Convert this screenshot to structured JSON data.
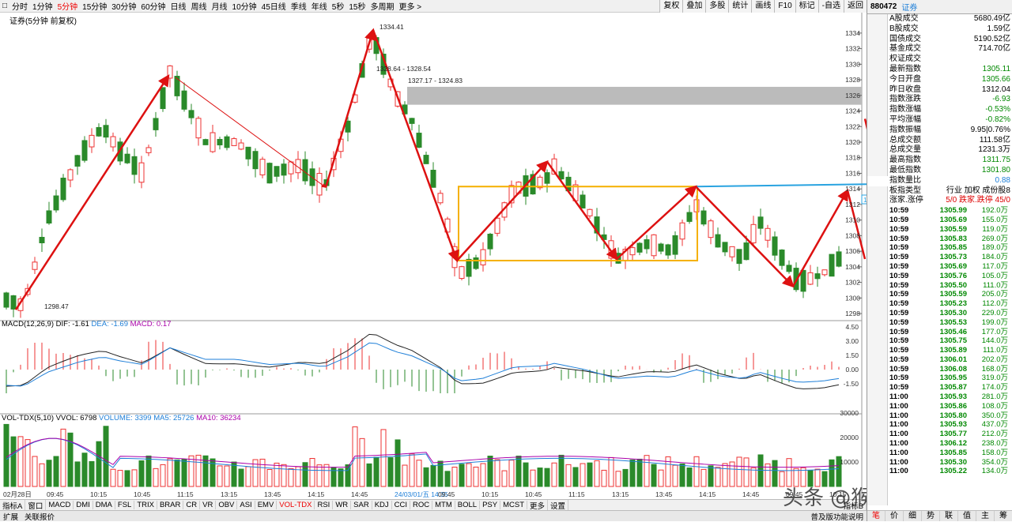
{
  "toolbar": {
    "period_tabs": [
      "分时",
      "1分钟",
      "5分钟",
      "15分钟",
      "30分钟",
      "60分钟",
      "日线",
      "周线",
      "月线",
      "10分钟",
      "45日线",
      "季线",
      "年线",
      "5秒",
      "15秒",
      "多周期",
      "更多 >"
    ],
    "active_period": "5分钟",
    "tools": [
      "复权",
      "叠加",
      "多股",
      "统计",
      "画线",
      "F10",
      "标记",
      "-自选",
      "返回"
    ]
  },
  "chart": {
    "title": "证券(5分钟 前复权)",
    "price_labels": [
      "1334",
      "1332",
      "1330",
      "1328",
      "1326",
      "1324",
      "1322",
      "1320",
      "1318",
      "1316",
      "1314",
      "1312",
      "1310",
      "1308",
      "1306",
      "1304",
      "1302",
      "1300",
      "1298"
    ],
    "annotations": {
      "high": "1334.41",
      "low": "1298.47",
      "range1": "1328.64 - 1328.54",
      "range2": "1327.17 - 1324.83",
      "current_tag": "1312.3",
      "pattern": "2B"
    },
    "time_labels": [
      "02月28日",
      "09:45",
      "10:15",
      "10:45",
      "11:15",
      "13:15",
      "13:45",
      "14:15",
      "14:45",
      "24/03/01/五 14:35",
      "09:45",
      "10:15",
      "10:45",
      "11:15",
      "13:15",
      "13:45",
      "14:15",
      "14:45",
      "09:45",
      "10:15"
    ]
  },
  "macd": {
    "title": "MACD(12,26,9)",
    "dif": "DIF: -1.61",
    "dea": "DEA: -1.69",
    "macd": "MACD: 0.17",
    "axis": [
      "4.50",
      "3.00",
      "1.50",
      "0.00",
      "-1.50"
    ]
  },
  "vol": {
    "title": "VOL-TDX(5,10)",
    "vvol": "VVOL: 6798",
    "volume": "VOLUME: 3399",
    "ma5": "MA5: 25726",
    "ma10": "MA10: 36234",
    "axis": [
      "30000",
      "20000",
      "10000"
    ]
  },
  "bottom_tabs": [
    "指标A",
    "窗口",
    "MACD",
    "DMI",
    "DMA",
    "FSL",
    "TRIX",
    "BRAR",
    "CR",
    "VR",
    "OBV",
    "ASI",
    "EMV",
    "VOL-TDX",
    "RSI",
    "WR",
    "SAR",
    "KDJ",
    "CCI",
    "ROC",
    "MTM",
    "BOLL",
    "PSY",
    "MCST",
    "更多",
    "设置"
  ],
  "active_bottom_tab": "VOL-TDX",
  "status": {
    "left1": "扩展",
    "left2": "关联报价",
    "right": "普及版功能说明",
    "right2": "指标B"
  },
  "right_panel": {
    "code": "880472",
    "name": "证券",
    "stats": [
      [
        "A股成交",
        "5680.49亿",
        ""
      ],
      [
        "B股成交",
        "1.59亿",
        ""
      ],
      [
        "国债成交",
        "5190.52亿",
        ""
      ],
      [
        "基金成交",
        "714.70亿",
        ""
      ],
      [
        "权证成交",
        "",
        ""
      ],
      [
        "最新指数",
        "1305.11",
        "g"
      ],
      [
        "今日开盘",
        "1305.66",
        "g"
      ],
      [
        "昨日收盘",
        "1312.04",
        ""
      ],
      [
        "指数涨跌",
        "-6.93",
        "g"
      ],
      [
        "指数涨幅",
        "-0.53%",
        "g"
      ],
      [
        "平均涨幅",
        "-0.82%",
        "g"
      ],
      [
        "指数振幅",
        "9.95|0.76%",
        ""
      ],
      [
        "总成交额",
        "111.58亿",
        ""
      ],
      [
        "总成交量",
        "1231.3万",
        ""
      ],
      [
        "最高指数",
        "1311.75",
        "g"
      ],
      [
        "最低指数",
        "1301.80",
        "g"
      ],
      [
        "指数量比",
        "0.88",
        ""
      ],
      [
        "板指类型",
        "行业 加权 成份股8",
        ""
      ],
      [
        "涨家.涨停",
        "5/0 跌家.跌停 45/0",
        "r"
      ]
    ],
    "ticks": [
      [
        "10:59",
        "1305.99",
        "192.0万"
      ],
      [
        "10:59",
        "1305.69",
        "155.0万"
      ],
      [
        "10:59",
        "1305.59",
        "119.0万"
      ],
      [
        "10:59",
        "1305.83",
        "269.0万"
      ],
      [
        "10:59",
        "1305.85",
        "189.0万"
      ],
      [
        "10:59",
        "1305.73",
        "184.0万"
      ],
      [
        "10:59",
        "1305.69",
        "117.0万"
      ],
      [
        "10:59",
        "1305.76",
        "105.0万"
      ],
      [
        "10:59",
        "1305.50",
        "111.0万"
      ],
      [
        "10:59",
        "1305.59",
        "205.0万"
      ],
      [
        "10:59",
        "1305.23",
        "112.0万"
      ],
      [
        "10:59",
        "1305.30",
        "229.0万"
      ],
      [
        "10:59",
        "1305.53",
        "199.0万"
      ],
      [
        "10:59",
        "1305.46",
        "177.0万"
      ],
      [
        "10:59",
        "1305.75",
        "144.0万"
      ],
      [
        "10:59",
        "1305.89",
        "111.0万"
      ],
      [
        "10:59",
        "1306.01",
        "202.0万"
      ],
      [
        "10:59",
        "1306.08",
        "168.0万"
      ],
      [
        "10:59",
        "1305.95",
        "319.0万"
      ],
      [
        "10:59",
        "1305.87",
        "174.0万"
      ],
      [
        "11:00",
        "1305.93",
        "281.0万"
      ],
      [
        "11:00",
        "1305.86",
        "108.0万"
      ],
      [
        "11:00",
        "1305.80",
        "350.0万"
      ],
      [
        "11:00",
        "1305.93",
        "437.0万"
      ],
      [
        "11:00",
        "1305.77",
        "212.0万"
      ],
      [
        "11:00",
        "1306.12",
        "238.0万"
      ],
      [
        "11:00",
        "1305.85",
        "158.0万"
      ],
      [
        "11:00",
        "1305.30",
        "354.0万"
      ],
      [
        "11:00",
        "1305.22",
        "134.0万"
      ]
    ],
    "foot": [
      "笔",
      "价",
      "细",
      "势",
      "联",
      "值",
      "主",
      "筹"
    ]
  },
  "watermark": "头条 @猴哥聊缠论"
}
